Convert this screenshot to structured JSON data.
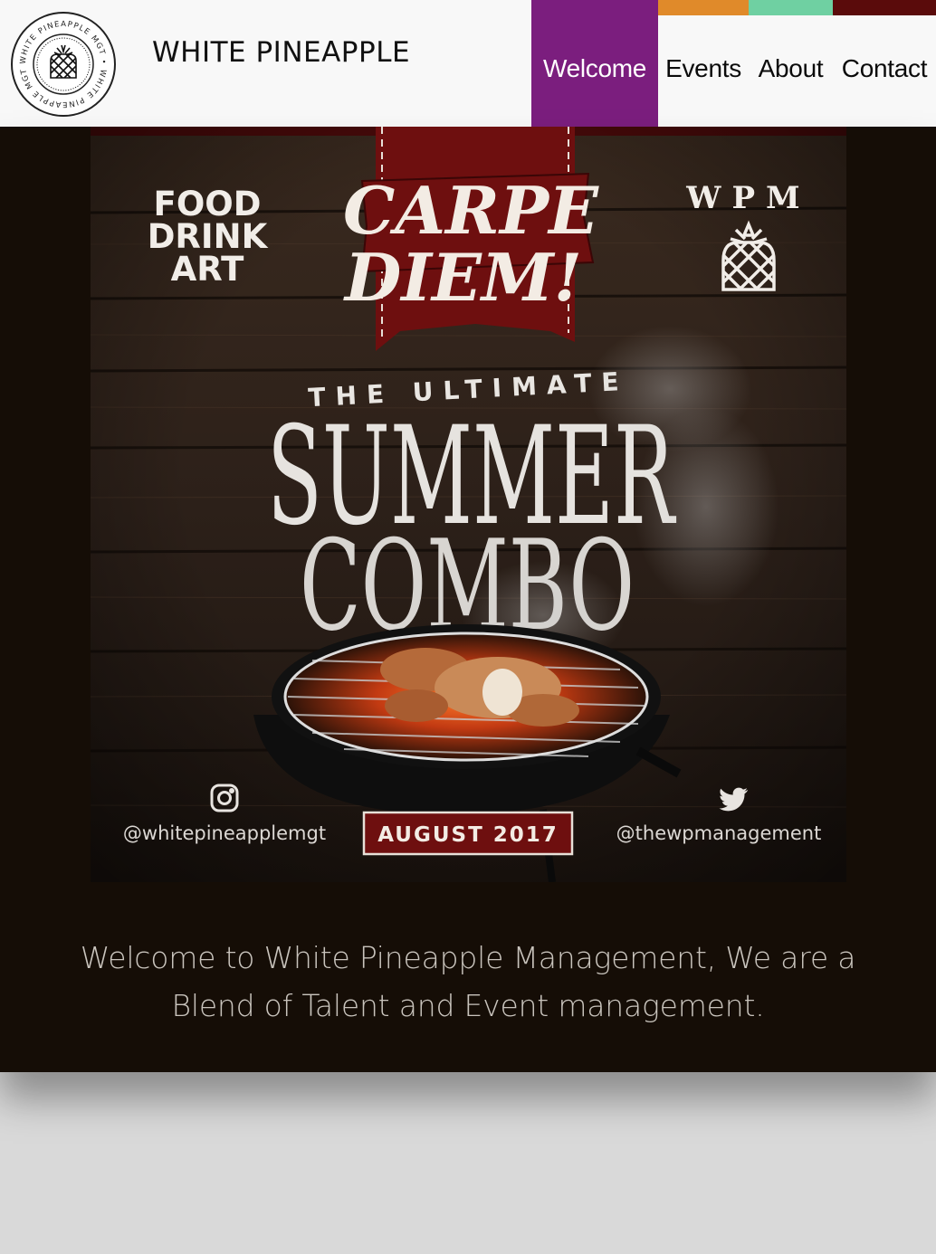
{
  "header": {
    "logo": {
      "icon": "pineapple-seal-icon",
      "ring_text": "WHITE PINEAPPLE MGT • WHITE PINEAPPLE MGT •"
    },
    "brand_name": "WHITE PINEAPPLE"
  },
  "nav": {
    "items": [
      {
        "label": "Welcome",
        "accent": "#7b1e7e",
        "active": true
      },
      {
        "label": "Events",
        "accent": "#e08a2a",
        "active": false
      },
      {
        "label": "About",
        "accent": "#6fd0a2",
        "active": false
      },
      {
        "label": "Contact",
        "accent": "#5a0b0b",
        "active": false
      }
    ]
  },
  "poster": {
    "tagline_lines": [
      "FOOD",
      "DRINK",
      "ART"
    ],
    "banner_line1": "CARPE",
    "banner_line2": "DIEM!",
    "brand_mark": "WPM",
    "subtitle": "THE ULTIMATE",
    "headline_line1": "SUMMER",
    "headline_line2": "COMBO",
    "instagram_handle": "@whitepineapplemgt",
    "instagram_icon": "instagram-icon",
    "date_badge": "AUGUST 2017",
    "twitter_handle": "@thewpmanagement",
    "twitter_icon": "twitter-icon"
  },
  "welcome_text": "Welcome to White Pineapple Management, We are a Blend of Talent and Event management.",
  "colors": {
    "page_bg": "#d9d9d9",
    "header_bg": "#f8f8f8",
    "main_bg": "#150d06",
    "banner_red": "#6e0f0f",
    "welcome_text": "#c9c4bd"
  }
}
